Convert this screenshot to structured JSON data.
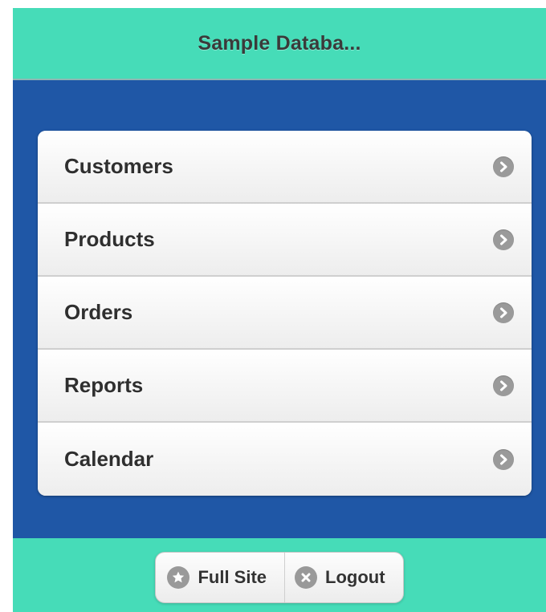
{
  "header": {
    "title": "Sample Databa..."
  },
  "menu": {
    "items": [
      {
        "label": "Customers",
        "icon": "chevron-right-icon"
      },
      {
        "label": "Products",
        "icon": "chevron-right-icon"
      },
      {
        "label": "Orders",
        "icon": "chevron-right-icon"
      },
      {
        "label": "Reports",
        "icon": "chevron-right-icon"
      },
      {
        "label": "Calendar",
        "icon": "chevron-right-icon"
      }
    ]
  },
  "footer": {
    "full_site": {
      "label": "Full Site",
      "icon": "star-icon"
    },
    "logout": {
      "label": "Logout",
      "icon": "close-icon"
    }
  },
  "colors": {
    "header_footer_bg": "#46dcb8",
    "content_bg": "#1f57a6",
    "icon_gray": "#9a9a9a"
  }
}
